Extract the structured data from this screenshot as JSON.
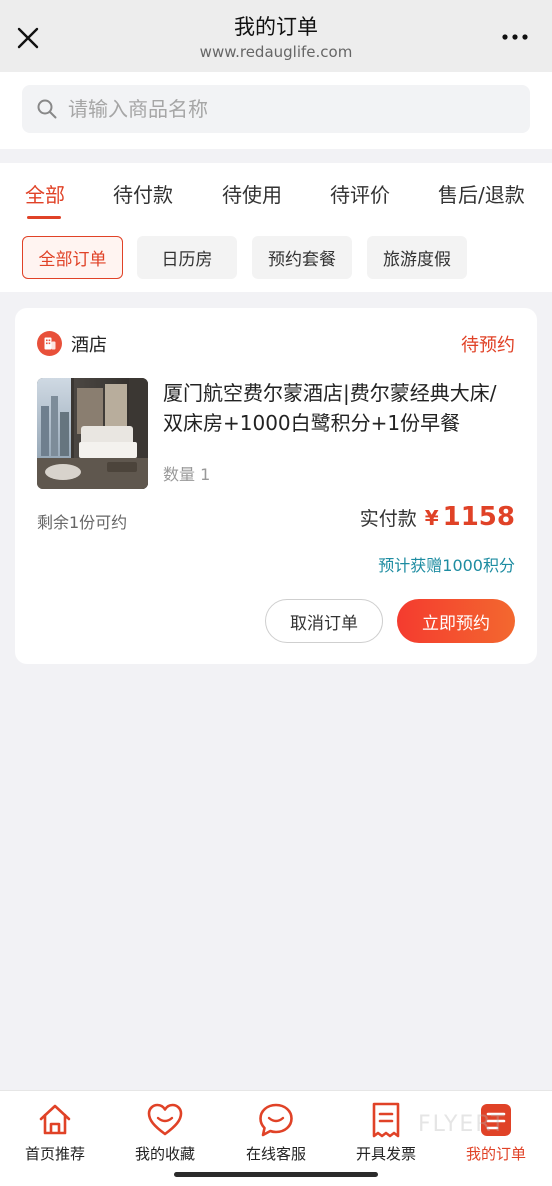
{
  "header": {
    "title": "我的订单",
    "url": "www.redauglife.com"
  },
  "search": {
    "placeholder": "请输入商品名称",
    "value": ""
  },
  "tabs": [
    {
      "label": "全部",
      "active": true
    },
    {
      "label": "待付款"
    },
    {
      "label": "待使用"
    },
    {
      "label": "待评价"
    },
    {
      "label": "售后/退款"
    }
  ],
  "filters": [
    {
      "label": "全部订单",
      "active": true
    },
    {
      "label": "日历房"
    },
    {
      "label": "预约套餐"
    },
    {
      "label": "旅游度假"
    }
  ],
  "order": {
    "store_name": "酒店",
    "status": "待预约",
    "product_title": "厦门航空费尔蒙酒店|费尔蒙经典大床/双床房+1000白鹭积分+1份早餐",
    "quantity_text": "数量 1",
    "remaining": "剩余1份可约",
    "paid_label": "实付款",
    "currency": "¥",
    "amount": "1158",
    "points_note": "预计获赠1000积分",
    "cancel_label": "取消订单",
    "book_label": "立即预约"
  },
  "bottom_nav": [
    {
      "label": "首页推荐",
      "icon": "home-icon"
    },
    {
      "label": "我的收藏",
      "icon": "heart-icon"
    },
    {
      "label": "在线客服",
      "icon": "chat-icon"
    },
    {
      "label": "开具发票",
      "icon": "receipt-icon"
    },
    {
      "label": "我的订单",
      "icon": "orders-icon",
      "active": true
    }
  ],
  "watermark": "FLYERT",
  "colors": {
    "accent": "#e04227",
    "points": "#1d8ca1",
    "background": "#f2f2f5"
  }
}
